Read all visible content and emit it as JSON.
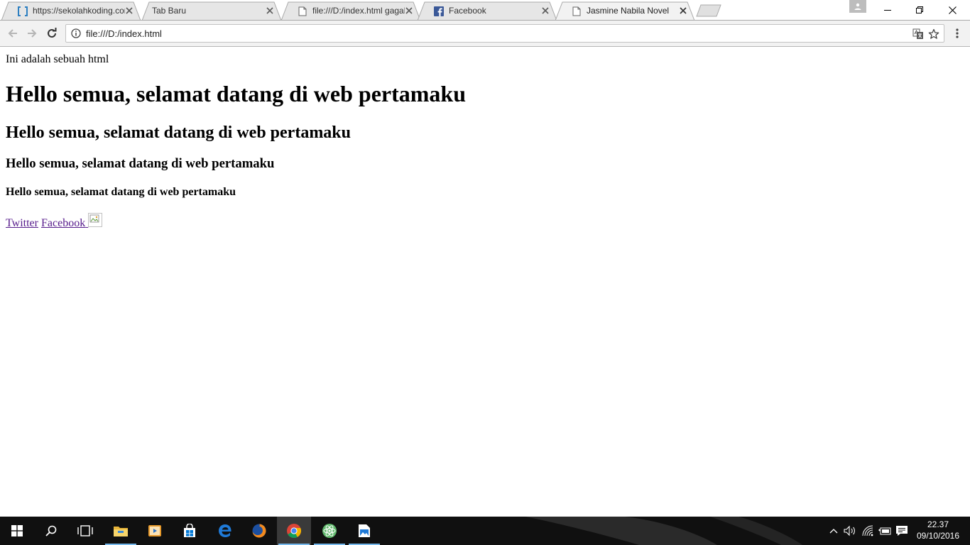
{
  "tabs": [
    {
      "title": "https://sekolahkoding.com",
      "icon": "bracket-favicon-icon",
      "active": false
    },
    {
      "title": "Tab Baru",
      "icon": "",
      "active": false
    },
    {
      "title": "file:///D:/index.html gagal",
      "icon": "document-icon",
      "active": false
    },
    {
      "title": "Facebook",
      "icon": "facebook-favicon-icon",
      "active": false
    },
    {
      "title": "Jasmine Nabila Novel",
      "icon": "document-icon",
      "active": true
    }
  ],
  "toolbar": {
    "url": "file:///D:/index.html"
  },
  "page": {
    "intro": "Ini adalah sebuah html",
    "h1": "Hello semua, selamat datang di web pertamaku",
    "h2": "Hello semua, selamat datang di web pertamaku",
    "h3": "Hello semua, selamat datang di web pertamaku",
    "h4": "Hello semua, selamat datang di web pertamaku",
    "link_twitter": "Twitter",
    "link_facebook": "Facebook"
  },
  "taskbar": {
    "apps": [
      "start-button",
      "search-button",
      "task-view-button",
      "file-explorer",
      "media-player",
      "store",
      "edge",
      "firefox",
      "chrome",
      "atom-like-app",
      "photos"
    ],
    "time": "22.37",
    "date": "09/10/2016"
  },
  "colors": {
    "visited_link": "#551a8b",
    "taskbar": "#101010",
    "toolbar": "#f2f2f2"
  }
}
